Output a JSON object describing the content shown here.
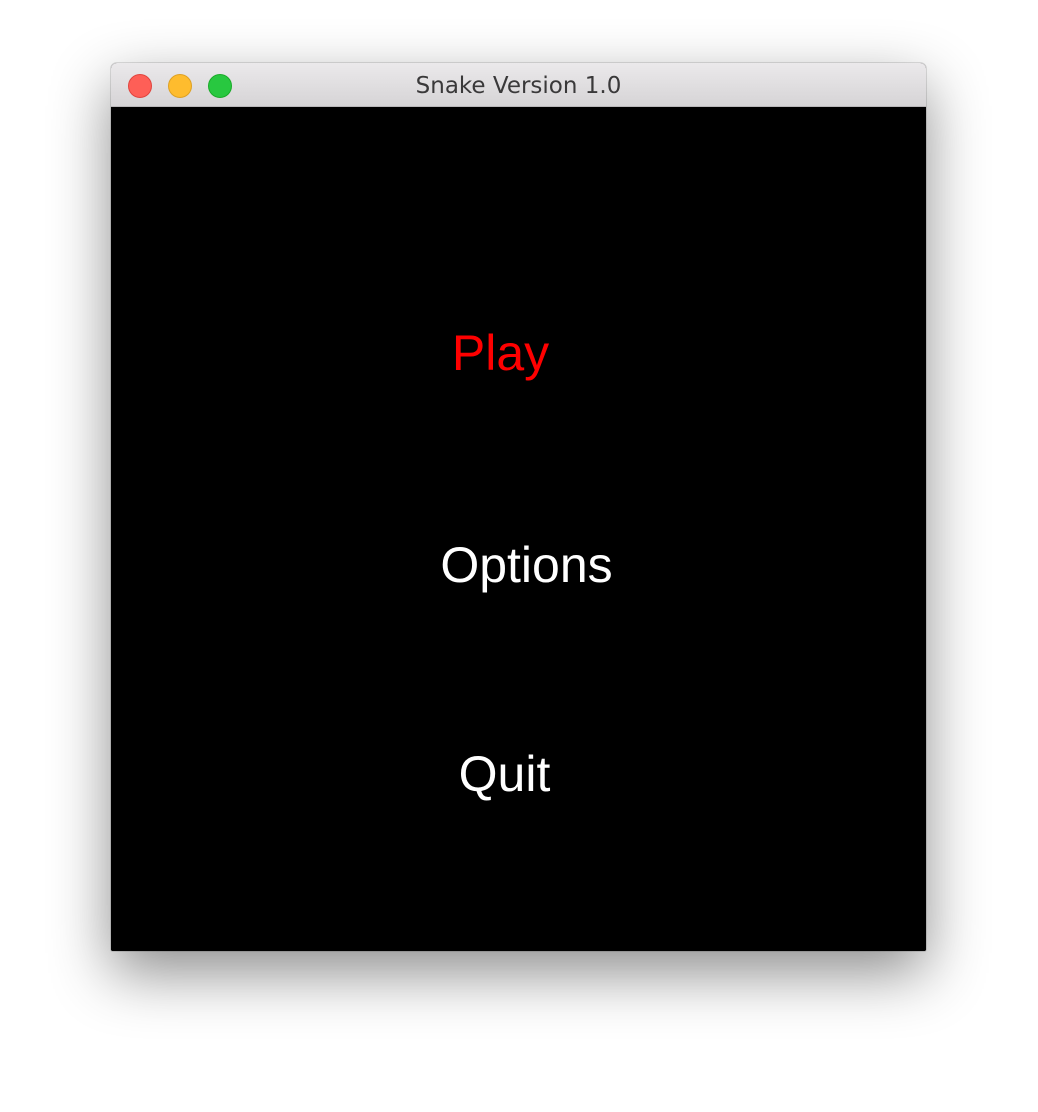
{
  "window": {
    "title": "Snake Version 1.0"
  },
  "menu": {
    "items": [
      {
        "label": "Play",
        "selected": true,
        "color": "#ff0000"
      },
      {
        "label": "Options",
        "selected": false,
        "color": "#ffffff"
      },
      {
        "label": "Quit",
        "selected": false,
        "color": "#ffffff"
      }
    ]
  },
  "colors": {
    "background": "#000000",
    "selected": "#ff0000",
    "unselected": "#ffffff"
  }
}
